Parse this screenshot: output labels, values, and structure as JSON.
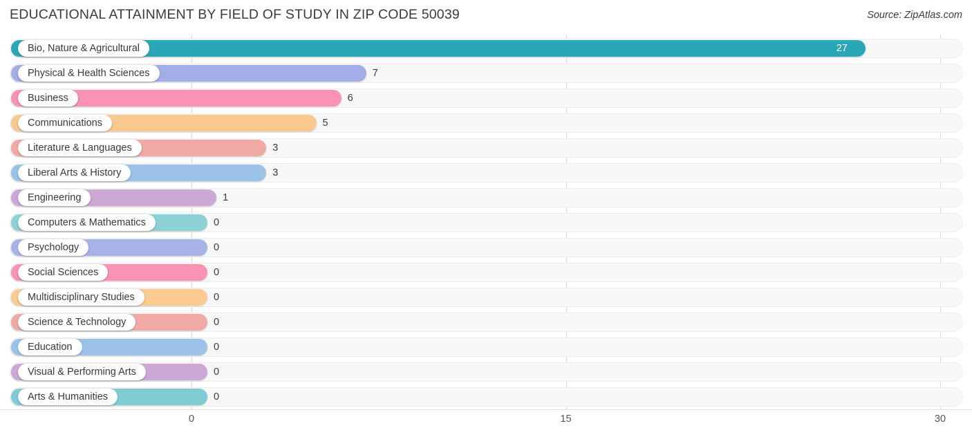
{
  "header": {
    "title": "EDUCATIONAL ATTAINMENT BY FIELD OF STUDY IN ZIP CODE 50039",
    "source": "Source: ZipAtlas.com"
  },
  "chart_data": {
    "type": "bar",
    "orientation": "horizontal",
    "title": "EDUCATIONAL ATTAINMENT BY FIELD OF STUDY IN ZIP CODE 50039",
    "xlabel": "",
    "ylabel": "",
    "xlim": [
      0,
      30
    ],
    "xticks": [
      "0",
      "15",
      "30"
    ],
    "xtick_values": [
      0,
      15,
      30
    ],
    "grid": true,
    "legend": "none",
    "categories": [
      "Bio, Nature & Agricultural",
      "Physical & Health Sciences",
      "Business",
      "Communications",
      "Literature & Languages",
      "Liberal Arts & History",
      "Engineering",
      "Computers & Mathematics",
      "Psychology",
      "Social Sciences",
      "Multidisciplinary Studies",
      "Science & Technology",
      "Education",
      "Visual & Performing Arts",
      "Arts & Humanities"
    ],
    "values": [
      27,
      7,
      6,
      5,
      3,
      3,
      1,
      0,
      0,
      0,
      0,
      0,
      0,
      0,
      0
    ],
    "value_labels": [
      "27",
      "7",
      "6",
      "5",
      "3",
      "3",
      "1",
      "0",
      "0",
      "0",
      "0",
      "0",
      "0",
      "0",
      "0"
    ],
    "colors": [
      "#2AA7B7",
      "#A3AEE8",
      "#F893B4",
      "#F9C88F",
      "#F0A9A5",
      "#9CC2EA",
      "#CCA8D4",
      "#8BD1D6",
      "#A8B4E8",
      "#F893B4",
      "#FBCB92",
      "#F0A9A5",
      "#9CC2EA",
      "#CCA8D4",
      "#7FCDD2"
    ]
  },
  "axis": {
    "ticks": [
      {
        "label": "0",
        "value": 0
      },
      {
        "label": "15",
        "value": 15
      },
      {
        "label": "30",
        "value": 30
      }
    ]
  },
  "style": {
    "track_bg": "#f7f7f7",
    "grid_color": "#d9d9d9",
    "text_color": "#3a3a3a"
  }
}
